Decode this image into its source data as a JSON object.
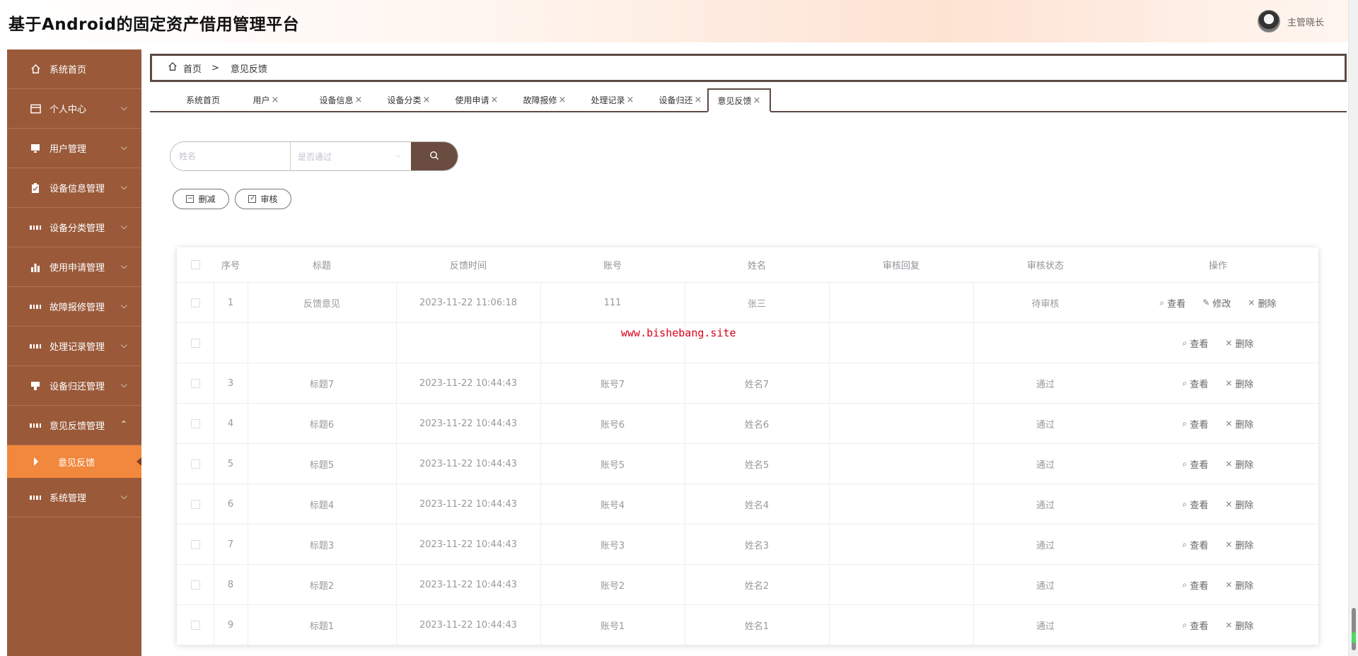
{
  "header": {
    "title": "基于Android的固定资产借用管理平台",
    "user_name": "主管晓长"
  },
  "sidebar": {
    "items": [
      {
        "label": "系统首页",
        "icon": "home-icon"
      },
      {
        "label": "个人中心",
        "icon": "card-icon"
      },
      {
        "label": "用户管理",
        "icon": "monitor-icon"
      },
      {
        "label": "设备信息管理",
        "icon": "clipboard-icon"
      },
      {
        "label": "设备分类管理",
        "icon": "grid-icon"
      },
      {
        "label": "使用申请管理",
        "icon": "bar-chart-icon"
      },
      {
        "label": "故障报修管理",
        "icon": "grid-icon"
      },
      {
        "label": "处理记录管理",
        "icon": "grid-icon"
      },
      {
        "label": "设备归还管理",
        "icon": "pin-icon"
      },
      {
        "label": "意见反馈管理",
        "icon": "grid-icon"
      }
    ],
    "sub_item": "意见反馈",
    "last_item": {
      "label": "系统管理",
      "icon": "grid-icon"
    }
  },
  "breadcrumb": {
    "home": "首页",
    "separator": ">",
    "current": "意见反馈"
  },
  "tabs": [
    {
      "label": "系统首页",
      "closable": false
    },
    {
      "label": "用户",
      "closable": true
    },
    {
      "label": "设备信息",
      "closable": true
    },
    {
      "label": "设备分类",
      "closable": true
    },
    {
      "label": "使用申请",
      "closable": true
    },
    {
      "label": "故障报修",
      "closable": true
    },
    {
      "label": "处理记录",
      "closable": true
    },
    {
      "label": "设备归还",
      "closable": true
    },
    {
      "label": "意见反馈",
      "closable": true
    }
  ],
  "tab_close_glyph": "×",
  "search": {
    "name_placeholder": "姓名",
    "status_placeholder": "是否通过"
  },
  "actions": {
    "delete_label": "删减",
    "audit_label": "审核"
  },
  "table": {
    "columns": [
      "序号",
      "标题",
      "反馈时间",
      "账号",
      "姓名",
      "审核回复",
      "审核状态",
      "操作"
    ],
    "rows": [
      {
        "no": "1",
        "title": "反馈意见",
        "time": "2023-11-22 11:06:18",
        "account": "111",
        "name": "张三",
        "reply": "",
        "status": "待审核",
        "ops": [
          "查看",
          "修改",
          "删除"
        ]
      },
      {
        "no": "",
        "title": "",
        "time": "",
        "account": "",
        "name": "",
        "reply": "",
        "status": "",
        "ops": [
          "查看",
          "删除"
        ]
      },
      {
        "no": "3",
        "title": "标题7",
        "time": "2023-11-22 10:44:43",
        "account": "账号7",
        "name": "姓名7",
        "reply": "",
        "status": "通过",
        "ops": [
          "查看",
          "删除"
        ]
      },
      {
        "no": "4",
        "title": "标题6",
        "time": "2023-11-22 10:44:43",
        "account": "账号6",
        "name": "姓名6",
        "reply": "",
        "status": "通过",
        "ops": [
          "查看",
          "删除"
        ]
      },
      {
        "no": "5",
        "title": "标题5",
        "time": "2023-11-22 10:44:43",
        "account": "账号5",
        "name": "姓名5",
        "reply": "",
        "status": "通过",
        "ops": [
          "查看",
          "删除"
        ]
      },
      {
        "no": "6",
        "title": "标题4",
        "time": "2023-11-22 10:44:43",
        "account": "账号4",
        "name": "姓名4",
        "reply": "",
        "status": "通过",
        "ops": [
          "查看",
          "删除"
        ]
      },
      {
        "no": "7",
        "title": "标题3",
        "time": "2023-11-22 10:44:43",
        "account": "账号3",
        "name": "姓名3",
        "reply": "",
        "status": "通过",
        "ops": [
          "查看",
          "删除"
        ]
      },
      {
        "no": "8",
        "title": "标题2",
        "time": "2023-11-22 10:44:43",
        "account": "账号2",
        "name": "姓名2",
        "reply": "",
        "status": "通过",
        "ops": [
          "查看",
          "删除"
        ]
      },
      {
        "no": "9",
        "title": "标题1",
        "time": "2023-11-22 10:44:43",
        "account": "账号1",
        "name": "姓名1",
        "reply": "",
        "status": "通过",
        "ops": [
          "查看",
          "删除"
        ]
      }
    ]
  },
  "watermark": "www.bishebang.site",
  "colors": {
    "sidebar": "#9a5a3a",
    "active_sub": "#f2873e",
    "search_button": "#6a4d40",
    "frame": "#5b4b45"
  }
}
